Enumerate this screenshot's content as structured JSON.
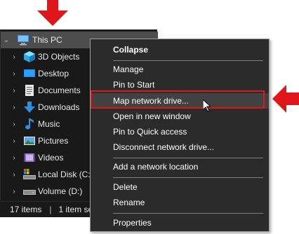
{
  "tree": {
    "root": {
      "label": "This PC",
      "icon": "this-pc-icon"
    },
    "items": [
      {
        "label": "3D Objects",
        "icon": "3d-objects-icon"
      },
      {
        "label": "Desktop",
        "icon": "desktop-folder-icon"
      },
      {
        "label": "Documents",
        "icon": "documents-folder-icon"
      },
      {
        "label": "Downloads",
        "icon": "downloads-folder-icon"
      },
      {
        "label": "Music",
        "icon": "music-folder-icon"
      },
      {
        "label": "Pictures",
        "icon": "pictures-folder-icon"
      },
      {
        "label": "Videos",
        "icon": "videos-folder-icon"
      },
      {
        "label": "Local Disk (C:)",
        "icon": "local-disk-icon"
      },
      {
        "label": "Volume (D:)",
        "icon": "volume-drive-icon"
      }
    ]
  },
  "statusbar": {
    "items": "17 items",
    "separator": "|",
    "selected": "1 item se"
  },
  "menu": {
    "collapse": "Collapse",
    "manage": "Manage",
    "pin_start": "Pin to Start",
    "map_drive": "Map network drive...",
    "open_new_window": "Open in new window",
    "pin_quick": "Pin to Quick access",
    "disconnect": "Disconnect network drive...",
    "add_location": "Add a network location",
    "delete": "Delete",
    "rename": "Rename",
    "properties": "Properties"
  },
  "colors": {
    "annotation": "#e0161b",
    "pane_background": "#191919",
    "menu_background": "#2b2b2b",
    "selected_row": "#4d4d4d"
  }
}
